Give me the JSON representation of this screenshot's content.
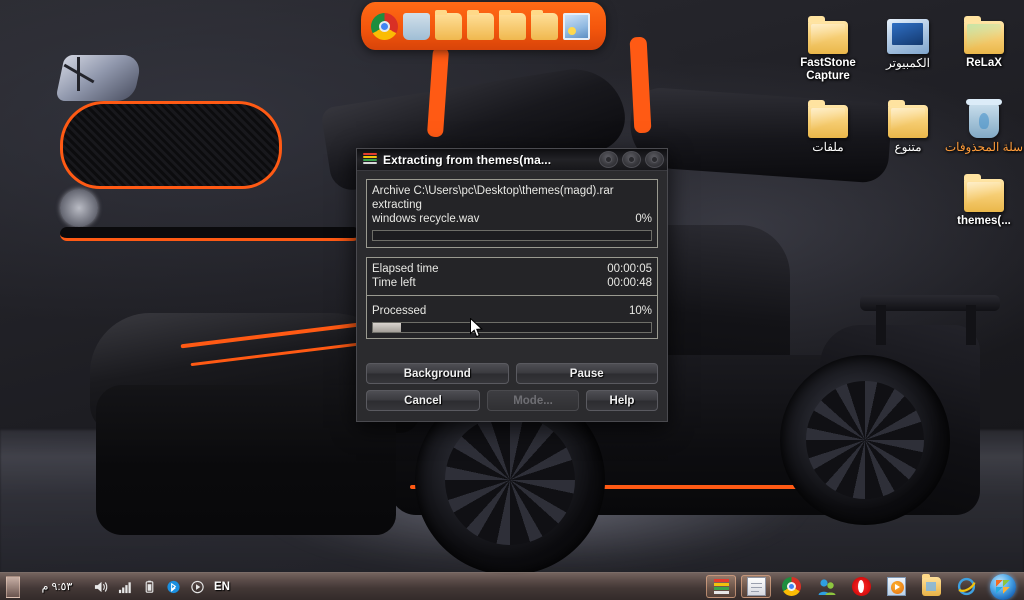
{
  "desktop": {
    "wallpaper_description": "black Mercedes-Benz SLS AMG with orange accents, gullwing doors open",
    "icons": [
      {
        "name": "faststone-capture",
        "label": "FastStone Capture",
        "icon": "folder-icon",
        "rtl": false
      },
      {
        "name": "computer",
        "label": "الكمبيوتر",
        "icon": "computer-icon",
        "rtl": true
      },
      {
        "name": "relax",
        "label": "ReLaX",
        "icon": "folder-icon",
        "rtl": false
      },
      {
        "name": "files",
        "label": "ملفات",
        "icon": "folder-icon",
        "rtl": true
      },
      {
        "name": "misc",
        "label": "متنوع",
        "icon": "folder-icon",
        "rtl": true
      },
      {
        "name": "recycle-bin",
        "label": "سلة المحذوفات",
        "icon": "recycle-bin-icon",
        "rtl": true
      },
      {
        "name": "themes-archive",
        "label": "themes(...",
        "icon": "folder-icon",
        "rtl": false
      }
    ]
  },
  "dock": {
    "items": [
      {
        "name": "chrome",
        "icon": "chrome-icon"
      },
      {
        "name": "recycle-bin",
        "icon": "recycle-bin-icon"
      },
      {
        "name": "folder-1",
        "icon": "folder-icon"
      },
      {
        "name": "folder-2",
        "icon": "folder-icon"
      },
      {
        "name": "folder-3",
        "icon": "folder-icon"
      },
      {
        "name": "folder-4",
        "icon": "folder-icon"
      },
      {
        "name": "pictures",
        "icon": "picture-icon"
      }
    ]
  },
  "dialog": {
    "title": "Extracting from themes(ma...",
    "icon": "winrar-icon",
    "window_controls": [
      {
        "name": "minimize-button",
        "icon": "minimize-icon"
      },
      {
        "name": "maximize-button",
        "icon": "maximize-icon"
      },
      {
        "name": "close-button",
        "icon": "close-icon"
      }
    ],
    "archive_line": "Archive C:\\Users\\pc\\Desktop\\themes(magd).rar",
    "operation_line": "extracting",
    "current_file": "windows recycle.wav",
    "file_percent_label": "0%",
    "file_percent_value": 0,
    "elapsed_label": "Elapsed time",
    "elapsed_value": "00:00:05",
    "timeleft_label": "Time left",
    "timeleft_value": "00:00:48",
    "processed_label": "Processed",
    "processed_percent_label": "10%",
    "processed_percent_value": 10,
    "buttons": [
      {
        "name": "background-button",
        "label": "Background",
        "disabled": false
      },
      {
        "name": "pause-button",
        "label": "Pause",
        "disabled": false
      },
      {
        "name": "cancel-button",
        "label": "Cancel",
        "disabled": false
      },
      {
        "name": "mode-button",
        "label": "Mode...",
        "disabled": true
      },
      {
        "name": "help-button",
        "label": "Help",
        "disabled": false
      }
    ]
  },
  "taskbar": {
    "clock": "٩:٥٣ م",
    "language": "EN",
    "tray": [
      {
        "name": "volume-icon"
      },
      {
        "name": "network-signal-icon"
      },
      {
        "name": "battery-icon"
      },
      {
        "name": "bluetooth-icon"
      },
      {
        "name": "media-play-icon"
      }
    ],
    "tasks": [
      {
        "name": "winrar-task",
        "icon": "winrar-icon",
        "active": true
      },
      {
        "name": "notepad-task",
        "icon": "notepad-icon",
        "active": true
      },
      {
        "name": "chrome-task",
        "icon": "chrome-icon",
        "active": false
      },
      {
        "name": "messenger-task",
        "icon": "messenger-icon",
        "active": false
      },
      {
        "name": "opera-task",
        "icon": "opera-icon",
        "active": false
      },
      {
        "name": "media-player-task",
        "icon": "media-player-icon",
        "active": false
      },
      {
        "name": "explorer-task",
        "icon": "folder-explorer-icon",
        "active": false
      },
      {
        "name": "ie-task",
        "icon": "internet-explorer-icon",
        "active": false
      }
    ],
    "start_button": {
      "name": "start-orb",
      "icon": "windows-orb-icon"
    }
  },
  "colors": {
    "dock_orange": "#f4560c",
    "car_accent": "#ff5a14",
    "dialog_bg": "#2b2b2e",
    "selected_label": "#ff9c3a"
  }
}
